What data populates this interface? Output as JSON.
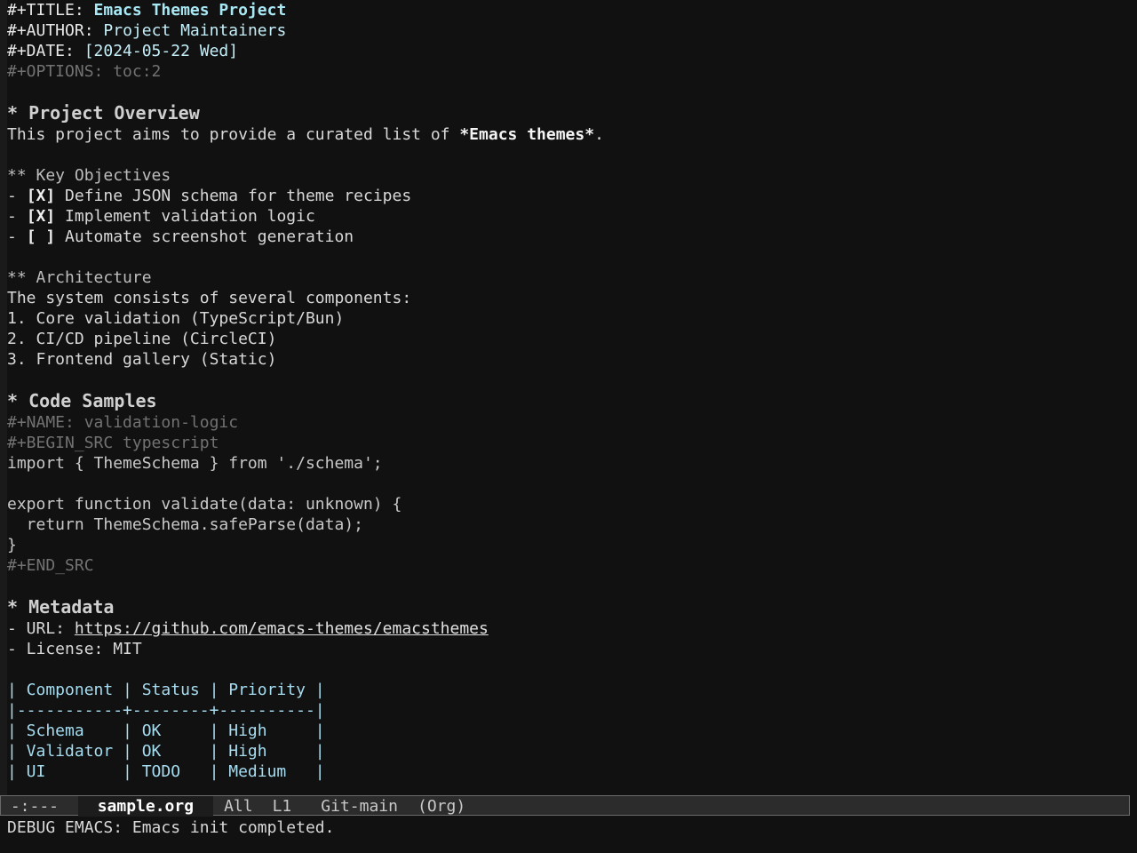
{
  "header": {
    "title_kw": "#+TITLE:",
    "title": "Emacs Themes Project",
    "author_kw": "#+AUTHOR:",
    "author": "Project Maintainers",
    "date_kw": "#+DATE:",
    "date": "[2024-05-22 Wed]",
    "options": "#+OPTIONS: toc:2"
  },
  "overview": {
    "heading": "* Project Overview",
    "text_prefix": "This project aims to provide a curated list of ",
    "text_bold": "*Emacs themes*",
    "text_suffix": "."
  },
  "objectives": {
    "heading": "** Key Objectives",
    "items": [
      {
        "bullet": "- ",
        "checkbox": "[X]",
        "text": " Define JSON schema for theme recipes"
      },
      {
        "bullet": "- ",
        "checkbox": "[X]",
        "text": " Implement validation logic"
      },
      {
        "bullet": "- ",
        "checkbox": "[ ]",
        "text": " Automate screenshot generation"
      }
    ]
  },
  "architecture": {
    "heading": "** Architecture",
    "intro": "The system consists of several components:",
    "items": [
      "1. Core validation (TypeScript/Bun)",
      "2. CI/CD pipeline (CircleCI)",
      "3. Frontend gallery (Static)"
    ]
  },
  "code_samples": {
    "heading": "* Code Samples",
    "name_line": "#+NAME: validation-logic",
    "begin_src": "#+BEGIN_SRC typescript",
    "lines": [
      "import { ThemeSchema } from './schema';",
      "",
      "export function validate(data: unknown) {",
      "  return ThemeSchema.safeParse(data);",
      "}"
    ],
    "end_src": "#+END_SRC"
  },
  "metadata": {
    "heading": "* Metadata",
    "url_prefix": "- URL: ",
    "url": "https://github.com/emacs-themes/emacsthemes",
    "license": "- License: MIT"
  },
  "table": {
    "rows": [
      "| Component | Status | Priority |",
      "|-----------+--------+----------|",
      "| Schema    | OK     | High     |",
      "| Validator | OK     | High     |",
      "| UI        | TODO   | Medium   |"
    ]
  },
  "modeline": {
    "status": " -:---  ",
    "buffer": "sample.org",
    "position": "All",
    "line": "L1",
    "vc": "Git-main",
    "mode": "(Org)"
  },
  "echo_area": "DEBUG EMACS: Emacs init completed."
}
